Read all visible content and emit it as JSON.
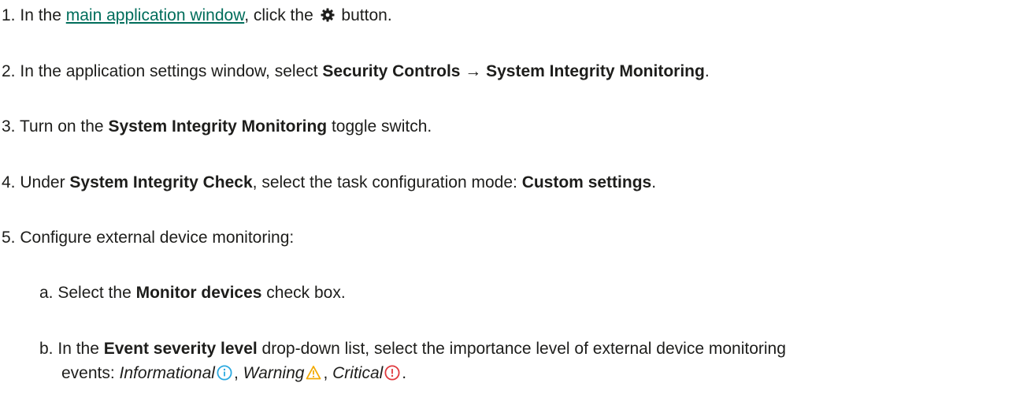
{
  "steps": {
    "s1": {
      "num": "1.",
      "pre": "In the ",
      "link": "main application window",
      "mid": ", click the ",
      "icon": "gear-icon",
      "post": " button."
    },
    "s2": {
      "num": "2.",
      "pre": "In the application settings window, select ",
      "b1": "Security Controls → System Integrity Monitoring",
      "post": "."
    },
    "s3": {
      "num": "3.",
      "pre": "Turn on the ",
      "b1": "System Integrity Monitoring",
      "post": " toggle switch."
    },
    "s4": {
      "num": "4.",
      "pre": "Under ",
      "b1": "System Integrity Check",
      "mid": ", select the task configuration mode: ",
      "b2": "Custom settings",
      "post": "."
    },
    "s5": {
      "num": "5.",
      "text": "Configure external device monitoring:"
    },
    "s5a": {
      "num": "a.",
      "pre": "Select the ",
      "b1": "Monitor devices",
      "post": " check box."
    },
    "s5b": {
      "num": "b.",
      "pre": "In the ",
      "b1": "Event severity level",
      "post": " drop-down list, select the importance level of external device monitoring",
      "line2_pre": "events: ",
      "info_label": "Informational",
      "info_icon": "info-icon",
      "sep1": ", ",
      "warning_label": "Warning",
      "warning_icon": "warning-icon",
      "sep2": ", ",
      "critical_label": "Critical",
      "critical_icon": "critical-icon",
      "end": "."
    }
  },
  "colors": {
    "text": "#1d1d1b",
    "link": "#006d5b",
    "info": "#2aa9e0",
    "warning": "#f2a900",
    "critical": "#e0393e"
  }
}
